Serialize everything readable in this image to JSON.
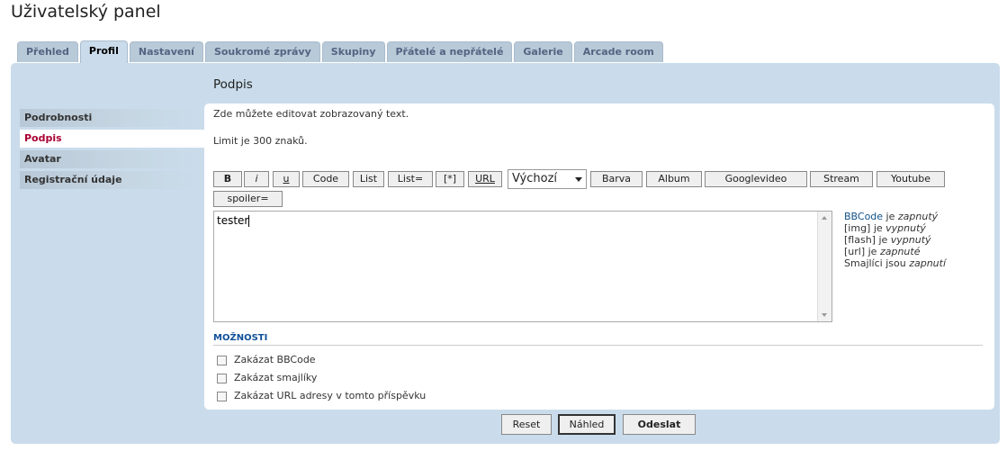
{
  "page_title": "Uživatelský panel",
  "tabs": [
    {
      "label": "Přehled"
    },
    {
      "label": "Profil",
      "active": true
    },
    {
      "label": "Nastavení"
    },
    {
      "label": "Soukromé zprávy"
    },
    {
      "label": "Skupiny"
    },
    {
      "label": "Přátelé a nepřátelé"
    },
    {
      "label": "Galerie"
    },
    {
      "label": "Arcade room"
    }
  ],
  "section_title": "Podpis",
  "subnav": [
    {
      "label": "Podrobnosti"
    },
    {
      "label": "Podpis",
      "active": true
    },
    {
      "label": "Avatar"
    },
    {
      "label": "Registrační údaje"
    }
  ],
  "intro": "Zde můžete editovat zobrazovaný text.",
  "limit": "Limit je 300 znaků.",
  "toolbar": {
    "bold": "B",
    "italic": "i",
    "underline": "u",
    "code": "Code",
    "list": "List",
    "list_eq": "List=",
    "list_item": "[*]",
    "url": "URL",
    "font_size_select": "Výchozí",
    "color": "Barva",
    "album": "Album",
    "googlevideo": "Googlevideo",
    "stream": "Stream",
    "youtube": "Youtube",
    "spoiler": "spoiler="
  },
  "editor": {
    "value": "tester"
  },
  "status": {
    "bbcode_link": "BBCode",
    "bbcode_rest": " je ",
    "bbcode_state": "zapnutý",
    "img_label": "[img] je ",
    "img_state": "vypnutý",
    "flash_label": "[flash] je ",
    "flash_state": "vypnutý",
    "url_label": "[url] je ",
    "url_state": "zapnuté",
    "smilies_label": "Smajlíci jsou ",
    "smilies_state": "zapnutí"
  },
  "options": {
    "heading": "MOŽNOSTI",
    "items": [
      {
        "label": "Zakázat BBCode",
        "checked": false
      },
      {
        "label": "Zakázat smajlíky",
        "checked": false
      },
      {
        "label": "Zakázat URL adresy v tomto příspěvku",
        "checked": false
      }
    ]
  },
  "actions": {
    "reset": "Reset",
    "preview": "Náhled",
    "submit": "Odeslat"
  }
}
